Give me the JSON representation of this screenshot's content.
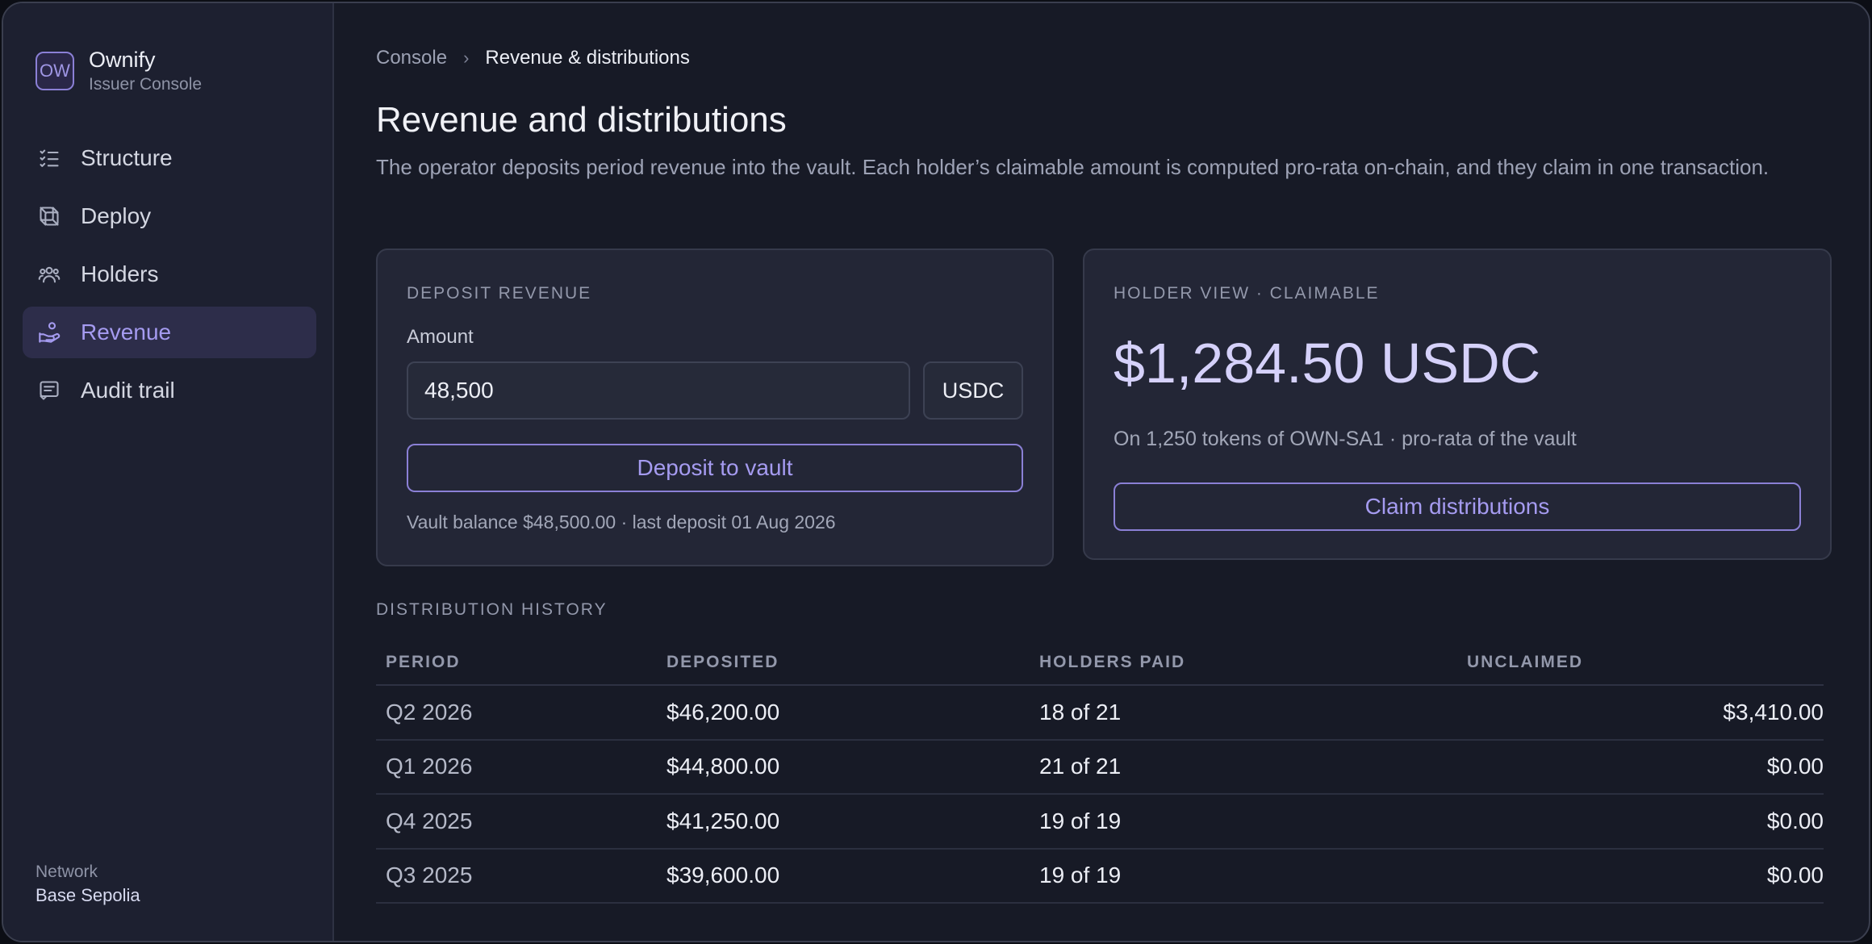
{
  "brand": {
    "logo": "OW",
    "name": "Ownify",
    "subtitle": "Issuer Console"
  },
  "nav": {
    "items": [
      {
        "label": "Structure",
        "icon": "list-check-icon",
        "active": false
      },
      {
        "label": "Deploy",
        "icon": "cube-icon",
        "active": false
      },
      {
        "label": "Holders",
        "icon": "users-icon",
        "active": false
      },
      {
        "label": "Revenue",
        "icon": "hand-coin-icon",
        "active": true
      },
      {
        "label": "Audit trail",
        "icon": "receipt-icon",
        "active": false
      }
    ]
  },
  "network": {
    "label": "Network",
    "value": "Base Sepolia"
  },
  "breadcrumb": {
    "root": "Console",
    "separator": "›",
    "current": "Revenue & distributions"
  },
  "page": {
    "title": "Revenue and distributions",
    "description": "The operator deposits period revenue into the vault. Each holder’s claimable amount is computed pro-rata on-chain, and they claim in one transaction."
  },
  "deposit": {
    "section_label": "DEPOSIT REVENUE",
    "amount_label": "Amount",
    "amount_value": "48,500",
    "currency": "USDC",
    "button_label": "Deposit to vault",
    "vault_balance": "Vault balance $48,500.00 · last deposit 01 Aug 2026"
  },
  "holder": {
    "section_label": "HOLDER VIEW · CLAIMABLE",
    "amount": "$1,284.50 USDC",
    "subtitle": "On 1,250 tokens of OWN-SA1 · pro-rata of the vault",
    "button_label": "Claim distributions"
  },
  "history": {
    "section_label": "DISTRIBUTION HISTORY",
    "columns": [
      "PERIOD",
      "DEPOSITED",
      "HOLDERS PAID",
      "UNCLAIMED"
    ],
    "rows": [
      [
        "Q2 2026",
        "$46,200.00",
        "18 of 21",
        "$3,410.00"
      ],
      [
        "Q1 2026",
        "$44,800.00",
        "21 of 21",
        "$0.00"
      ],
      [
        "Q4 2025",
        "$41,250.00",
        "19 of 19",
        "$0.00"
      ],
      [
        "Q3 2025",
        "$39,600.00",
        "19 of 19",
        "$0.00"
      ]
    ]
  },
  "colors": {
    "accent": "#a59bf0",
    "background": "#171a26",
    "sidebar": "#1d2030",
    "card": "#232636"
  }
}
